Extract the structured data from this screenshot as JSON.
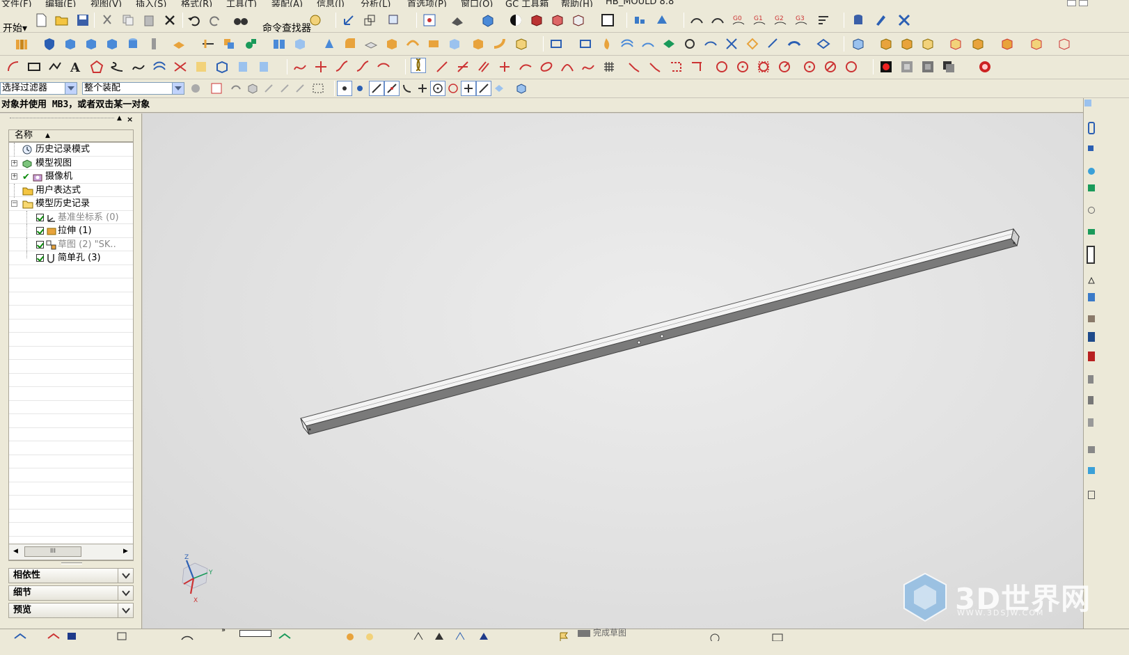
{
  "menu": {
    "items": [
      "文件(F)",
      "编辑(E)",
      "视图(V)",
      "插入(S)",
      "格式(R)",
      "工具(T)",
      "装配(A)",
      "信息(I)",
      "分析(L)",
      "首选项(P)",
      "窗口(O)",
      "GC 工具箱",
      "帮助(H)",
      "HB_MOULD 8.8"
    ]
  },
  "toolbar": {
    "start_label": "开始",
    "command_finder_label": "命令查找器"
  },
  "filter_bar": {
    "selection_filter": "选择过滤器",
    "scope": "整个装配"
  },
  "status": {
    "message": "对象并使用 MB3，或者双击某一对象"
  },
  "navigator": {
    "column_header": "名称",
    "nodes": [
      {
        "label": "历史记录模式",
        "icon": "clock-icon"
      },
      {
        "label": "模型视图",
        "icon": "model-views-icon"
      },
      {
        "label": "摄像机",
        "icon": "camera-icon"
      },
      {
        "label": "用户表达式",
        "icon": "folder-icon"
      },
      {
        "label": "模型历史记录",
        "icon": "folder-open-icon"
      },
      {
        "label": "基准坐标系 (0)",
        "icon": "datum-csys-icon"
      },
      {
        "label": "拉伸 (1)",
        "icon": "extrude-icon"
      },
      {
        "label": "草图 (2) \"SK..",
        "icon": "sketch-icon"
      },
      {
        "label": "简单孔 (3)",
        "icon": "hole-icon"
      }
    ],
    "scroll_thumb_label": "III",
    "panels": {
      "dependencies": "相依性",
      "details": "细节",
      "preview": "预览"
    }
  },
  "triad": {
    "x_label": "X",
    "y_label": "Y",
    "z_label": "Z"
  },
  "bottom_bar": {
    "label": "完成草图"
  },
  "watermark": {
    "brand": "3D世界网",
    "url": "WWW.3DSJW.COM"
  },
  "colors": {
    "accent_blue": "#2b5fb3",
    "check_green": "#0a8a0a",
    "viewport_bg": "#e0e0e0"
  }
}
